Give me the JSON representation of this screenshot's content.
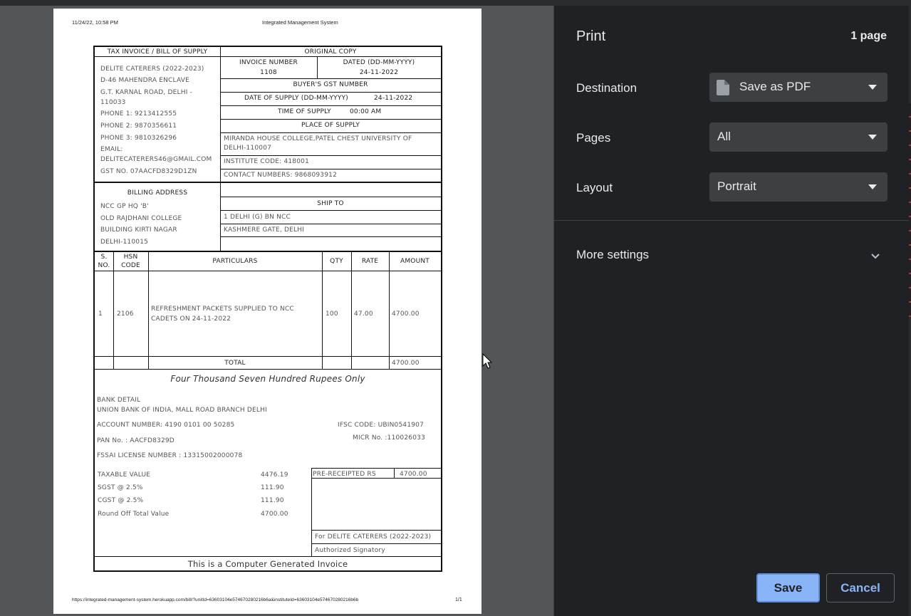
{
  "browser": {
    "header_timestamp": "11/24/22, 10:58 PM",
    "header_title": "Integrated Management System",
    "footer_url": "https://integrated-management-system.herokuapp.com/bill/?unitId=63603104e574670280216b6a&instituteId=63603104e574670280216b6b",
    "footer_page": "1/1"
  },
  "invoice": {
    "doc_type": "TAX INVOICE / BILL OF SUPPLY",
    "copy_label": "ORIGINAL COPY",
    "supplier": {
      "name": "DELITE CATERERS (2022-2023)",
      "address1": "D-46 MAHENDRA ENCLAVE",
      "address2": "G.T. KARNAL ROAD, DELHI -",
      "address3": "110033",
      "phone1": "PHONE 1: 9213412555",
      "phone2": "PHONE 2: 9870356611",
      "phone3": "PHONE 3: 9810326296",
      "email_label": "EMAIL:",
      "email": "DELITECATERERS46@GMAIL.COM",
      "gst": "GST NO. 07AACFD8329D1ZN"
    },
    "invoice_number_label": "INVOICE NUMBER",
    "invoice_number": "1108",
    "dated_label": "DATED (DD-MM-YYYY)",
    "dated": "24-11-2022",
    "buyer_gst_label": "BUYER'S GST NUMBER",
    "date_of_supply_label": "DATE OF SUPPLY (DD-MM-YYYY)",
    "date_of_supply": "24-11-2022",
    "time_of_supply_label": "TIME OF SUPPLY",
    "time_of_supply": "00:00 AM",
    "place_of_supply_label": "PLACE OF SUPPLY",
    "place_line1": "MIRANDA HOUSE COLLEGE,PATEL CHEST UNIVERSITY OF",
    "place_line2": "DELHI-110007",
    "institute_code": "INSTITUTE CODE: 418001",
    "contact_numbers": "CONTACT NUMBERS: 9868093912",
    "billing": {
      "title": "BILLING ADDRESS",
      "line1": "NCC GP HQ 'B'",
      "line2": "OLD RAJDHANI COLLEGE",
      "line3": "BUILDING KIRTI NAGAR",
      "line4": "DELHI-110015"
    },
    "ship_to": {
      "title": "SHIP TO",
      "line1": "1 DELHI (G) BN NCC",
      "line2": "KASHMERE GATE, DELHI"
    },
    "columns": {
      "sno_1": "S.",
      "sno_2": "NO.",
      "hsn_1": "HSN",
      "hsn_2": "CODE",
      "particulars": "PARTICULARS",
      "qty": "QTY",
      "rate": "RATE",
      "amount": "AMOUNT"
    },
    "item": {
      "sno": "1",
      "hsn": "2106",
      "particulars_1": "REFRESHMENT PACKETS SUPPLIED TO NCC",
      "particulars_2": "CADETS ON 24-11-2022",
      "qty": "100",
      "rate": "47.00",
      "amount": "4700.00"
    },
    "total_label": "TOTAL",
    "total_amount": "4700.00",
    "amount_in_words": "Four Thousand Seven Hundred Rupees Only",
    "bank": {
      "title": "BANK DETAIL",
      "name": "UNION BANK OF INDIA, MALL ROAD BRANCH DELHI",
      "account": "ACCOUNT NUMBER: 4190 0101 00 50285",
      "ifsc": "IFSC CODE: UBIN0541907",
      "micr": "MICR No. :110026033",
      "pan": "PAN No. : AACFD8329D",
      "fssai": "FSSAI LICENSE NUMBER : 13315002000078"
    },
    "tax": {
      "taxable_label": "TAXABLE VALUE",
      "taxable_value": "4476.19",
      "sgst_label": "SGST @ 2.5%",
      "sgst_value": "111.90",
      "cgst_label": "CGST @ 2.5%",
      "cgst_value": "111.90",
      "roundoff_label": "Round Off Total Value",
      "roundoff_value": "4700.00"
    },
    "pre_receipted_label": "PRE-RECEIPTED RS",
    "pre_receipted_value": "4700.00",
    "for_company": "For DELITE CATERERS (2022-2023)",
    "signatory": "Authorized Signatory",
    "footer_note": "This is a Computer Generated Invoice"
  },
  "print_panel": {
    "title": "Print",
    "page_count": "1 page",
    "destination_label": "Destination",
    "destination_value": "Save as PDF",
    "destination_icon": "document-icon",
    "pages_label": "Pages",
    "pages_value": "All",
    "layout_label": "Layout",
    "layout_value": "Portrait",
    "more_settings": "More settings",
    "save_button": "Save",
    "cancel_button": "Cancel",
    "accent_color": "#8ab4f8"
  }
}
